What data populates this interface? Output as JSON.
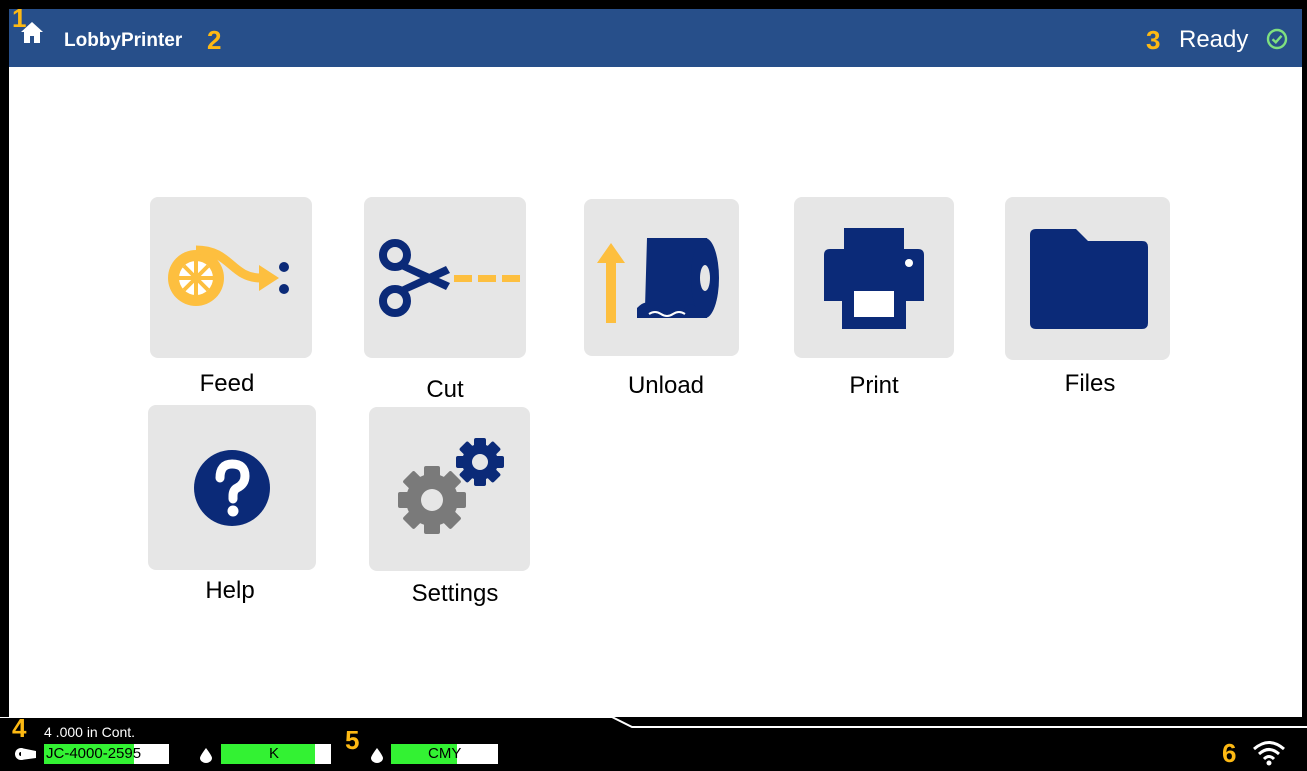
{
  "callouts": [
    "1",
    "2",
    "3",
    "4",
    "5",
    "6"
  ],
  "header": {
    "printer_name": "LobbyPrinter",
    "status": "Ready",
    "icons": [
      "home-icon",
      "ready-check-icon"
    ]
  },
  "tiles": [
    {
      "id": "feed",
      "label": "Feed",
      "icon": "feed-icon"
    },
    {
      "id": "cut",
      "label": "Cut",
      "icon": "scissors-icon"
    },
    {
      "id": "unload",
      "label": "Unload",
      "icon": "unload-icon"
    },
    {
      "id": "print",
      "label": "Print",
      "icon": "printer-icon"
    },
    {
      "id": "files",
      "label": "Files",
      "icon": "folder-icon"
    },
    {
      "id": "help",
      "label": "Help",
      "icon": "help-icon"
    },
    {
      "id": "settings",
      "label": "Settings",
      "icon": "gears-icon"
    }
  ],
  "status_bar": {
    "media_length": "4 .000 in Cont.",
    "label_part": "JC-4000-2595",
    "ink_k": {
      "label": "K",
      "level": 0.85
    },
    "ink_cmy": {
      "label": "CMY",
      "level": 0.62
    },
    "icons": [
      "label-roll-icon",
      "ink-drop-icon",
      "wifi-icon"
    ]
  },
  "colors": {
    "header_bg": "#274f8a",
    "callout": "#fdb913",
    "icon_blue": "#0b2a78",
    "icon_yellow": "#fdbf3f",
    "tile_bg": "#e6e6e6",
    "level_green": "#33f233"
  }
}
